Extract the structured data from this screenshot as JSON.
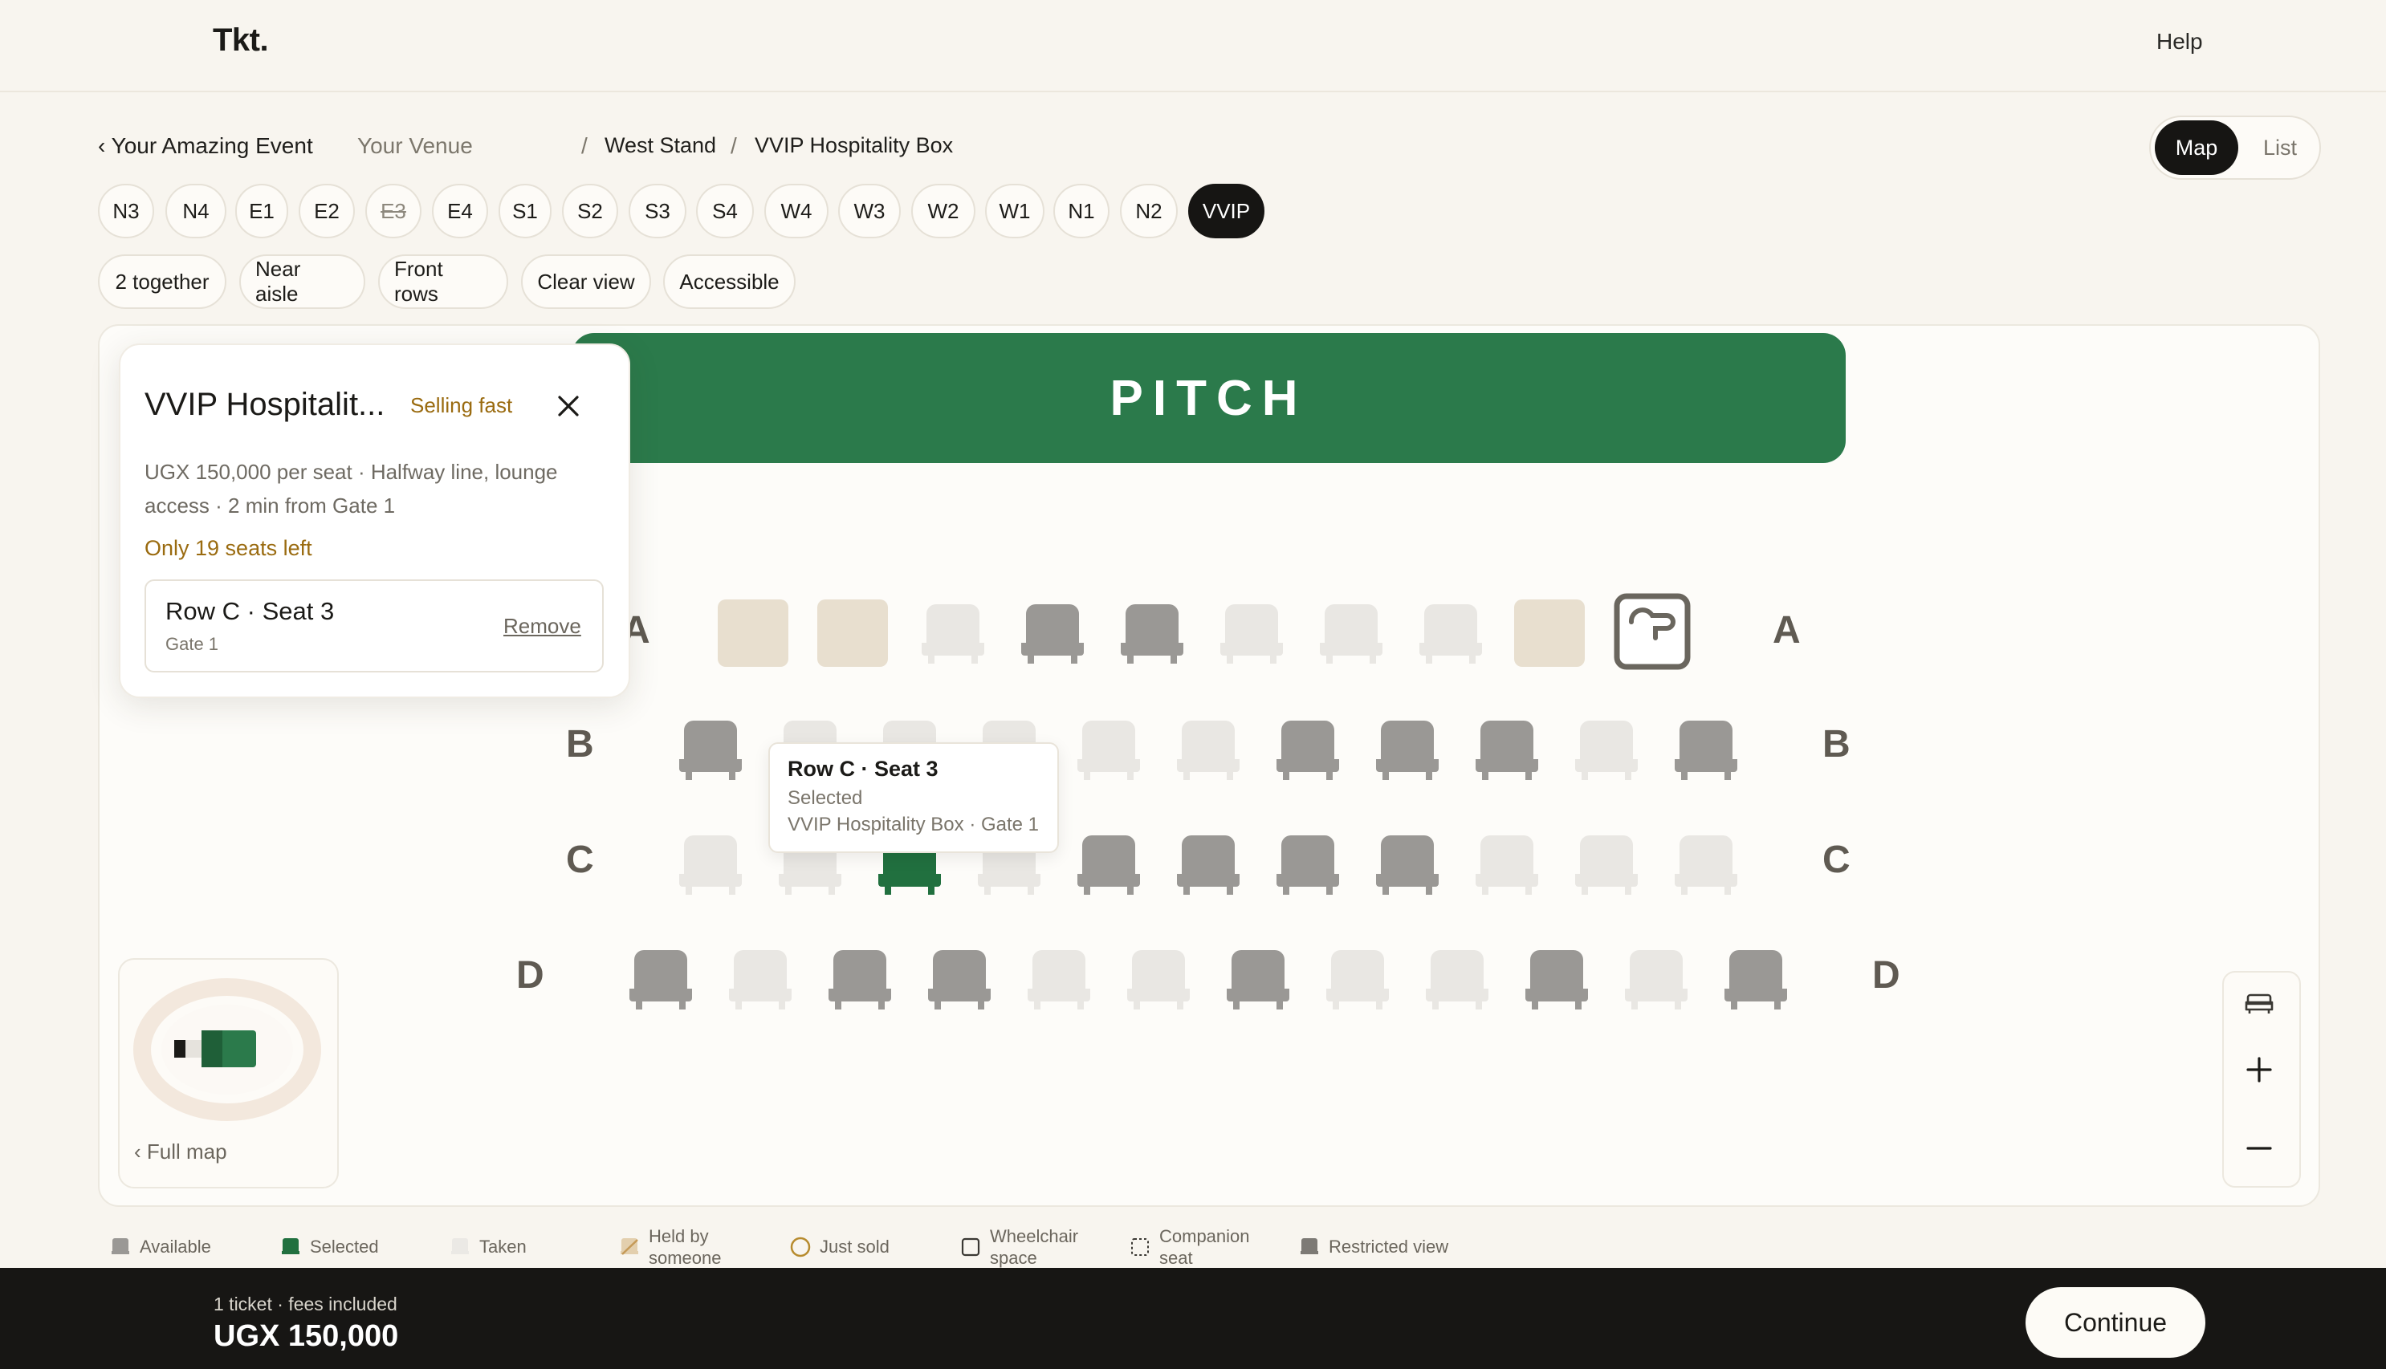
{
  "brand": "Tkt.",
  "help": "Help",
  "breadcrumb": {
    "back_event": "‹ Your Amazing Event",
    "venue": "Your Venue",
    "sep": "/",
    "stand": "West Stand",
    "box": "VVIP Hospitality Box"
  },
  "view_toggle": {
    "map": "Map",
    "list": "List"
  },
  "sections": [
    "N3",
    "N4",
    "E1",
    "E2",
    "E3",
    "E4",
    "S1",
    "S2",
    "S3",
    "S4",
    "W4",
    "W3",
    "W2",
    "W1",
    "N1",
    "N2",
    "VVIP"
  ],
  "filters": [
    "2 together",
    "Near aisle",
    "Front rows",
    "Clear view",
    "Accessible"
  ],
  "pitch": "PITCH",
  "rows": [
    "A",
    "B",
    "C",
    "D"
  ],
  "info_card": {
    "title": "VVIP Hospitalit...",
    "badge": "Selling fast",
    "desc": "UGX 150,000 per seat · Halfway line, lounge access · 2 min from Gate 1",
    "seats_left": "Only 19 seats left",
    "selection": {
      "title": "Row C · Seat 3",
      "gate": "Gate 1",
      "remove": "Remove"
    }
  },
  "tooltip": {
    "title": "Row C · Seat 3",
    "status": "Selected",
    "detail": "VVIP Hospitality Box · Gate 1"
  },
  "minimap": {
    "label": "‹ Full map"
  },
  "legend": {
    "available": "Available",
    "selected": "Selected",
    "taken": "Taken",
    "held_1": "Held by",
    "held_2": "someone",
    "just_sold": "Just sold",
    "wheel_1": "Wheelchair",
    "wheel_2": "space",
    "comp_1": "Companion",
    "comp_2": "seat",
    "restricted": "Restricted view"
  },
  "footer": {
    "summary": "1 ticket · fees included",
    "total": "UGX 150,000",
    "continue": "Continue"
  },
  "colors": {
    "pitch": "#2b7a4b",
    "available": "#9a9895",
    "taken": "#e9e7e3",
    "held": "#e8dfcf",
    "selected": "#21703f",
    "badge": "#9a6b10"
  },
  "seat_rows": [
    {
      "row": "A",
      "seats": [
        "held",
        "held",
        "taken",
        "available",
        "available",
        "taken",
        "taken",
        "taken",
        "held",
        "wheelchair"
      ]
    },
    {
      "row": "B",
      "seats": [
        "available",
        "taken",
        "taken",
        "taken",
        "taken",
        "taken",
        "available",
        "available",
        "available",
        "taken",
        "available"
      ]
    },
    {
      "row": "C",
      "seats": [
        "taken",
        "taken",
        "selected",
        "taken",
        "available",
        "available",
        "available",
        "available",
        "taken",
        "taken",
        "taken"
      ]
    },
    {
      "row": "D",
      "seats": [
        "available",
        "taken",
        "available",
        "available",
        "taken",
        "taken",
        "available",
        "taken",
        "taken",
        "available",
        "taken",
        "available"
      ]
    }
  ]
}
